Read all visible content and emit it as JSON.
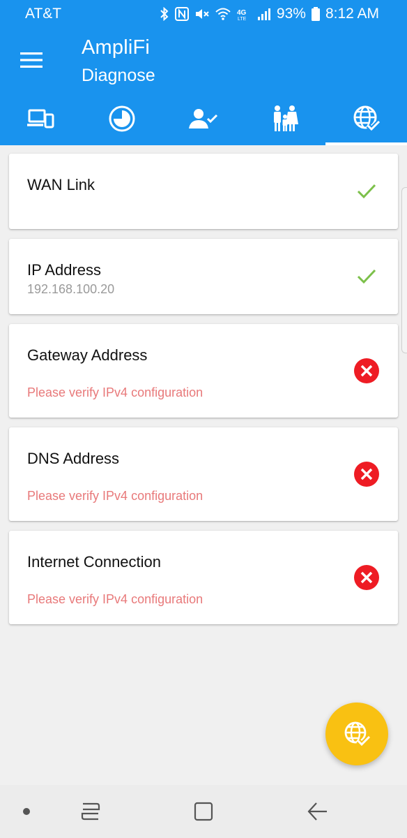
{
  "status_bar": {
    "carrier": "AT&T",
    "network": "4G LTE",
    "battery": "93%",
    "time": "8:12 AM"
  },
  "app_bar": {
    "title": "AmpliFi",
    "subtitle": "Diagnose"
  },
  "tabs": [
    {
      "icon": "devices-icon",
      "active": false
    },
    {
      "icon": "speed-icon",
      "active": false
    },
    {
      "icon": "user-check-icon",
      "active": false
    },
    {
      "icon": "family-icon",
      "active": false
    },
    {
      "icon": "globe-check-icon",
      "active": true
    }
  ],
  "checks": [
    {
      "title": "WAN Link",
      "detail": "",
      "status": "ok"
    },
    {
      "title": "IP Address",
      "detail": "192.168.100.20",
      "status": "ok"
    },
    {
      "title": "Gateway Address",
      "detail": "Please verify IPv4 configuration",
      "status": "error"
    },
    {
      "title": "DNS Address",
      "detail": "Please verify IPv4 configuration",
      "status": "error"
    },
    {
      "title": "Internet Connection",
      "detail": "Please verify IPv4 configuration",
      "status": "error"
    }
  ],
  "colors": {
    "primary": "#1993ee",
    "ok": "#7cc04a",
    "error": "#ee1c24",
    "error_text": "#e8797a",
    "fab": "#f9c112"
  }
}
